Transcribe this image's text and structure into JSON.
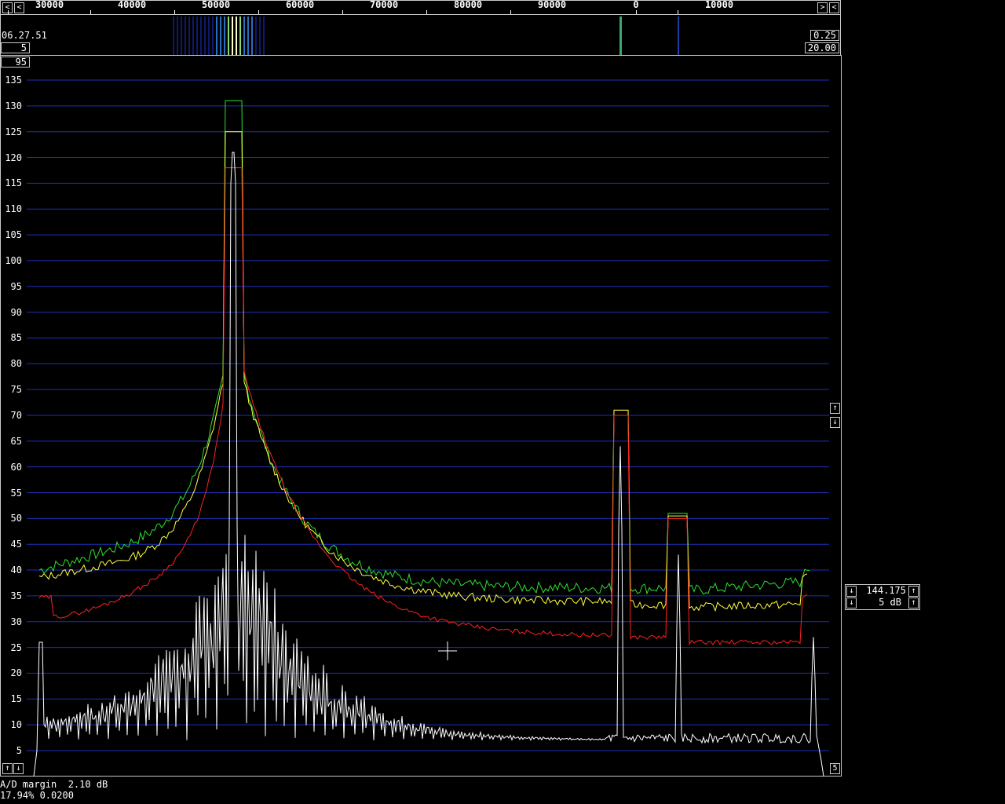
{
  "top_axis": {
    "labels": [
      "30000",
      "40000",
      "50000",
      "60000",
      "70000",
      "80000",
      "90000",
      "0",
      "10000"
    ],
    "left_arrow": "<",
    "right_arrow": ">",
    "right_arrow2": "<"
  },
  "waterfall": {
    "time": "06.27.51",
    "left_value1": "5",
    "left_value2": "95",
    "right_value1": "0.25",
    "right_value2": "20.00"
  },
  "spectrum": {
    "y_ticks": [
      "135",
      "130",
      "125",
      "120",
      "115",
      "110",
      "105",
      "100",
      "95",
      "90",
      "85",
      "80",
      "75",
      "70",
      "65",
      "60",
      "55",
      "50",
      "45",
      "40",
      "35",
      "30",
      "25",
      "20",
      "15",
      "10",
      "5"
    ],
    "colors": {
      "grid": "#1e2fb8",
      "green": "#2ee02e",
      "yellow": "#ffff40",
      "red": "#ff2020",
      "white": "#ffffff"
    },
    "bottom_left_up": "↑",
    "bottom_left_down": "↓",
    "bottom_right_value": "5",
    "right_up": "↑",
    "right_down": "↓"
  },
  "side_panel": {
    "freq_value": "144.175",
    "db_value": "5 dB",
    "up_arrow": "↑",
    "down_arrow": "↓"
  },
  "status": {
    "ad_margin": "A/D margin  2.10 dB",
    "bottom_line": "17.94% 0.0200"
  }
}
